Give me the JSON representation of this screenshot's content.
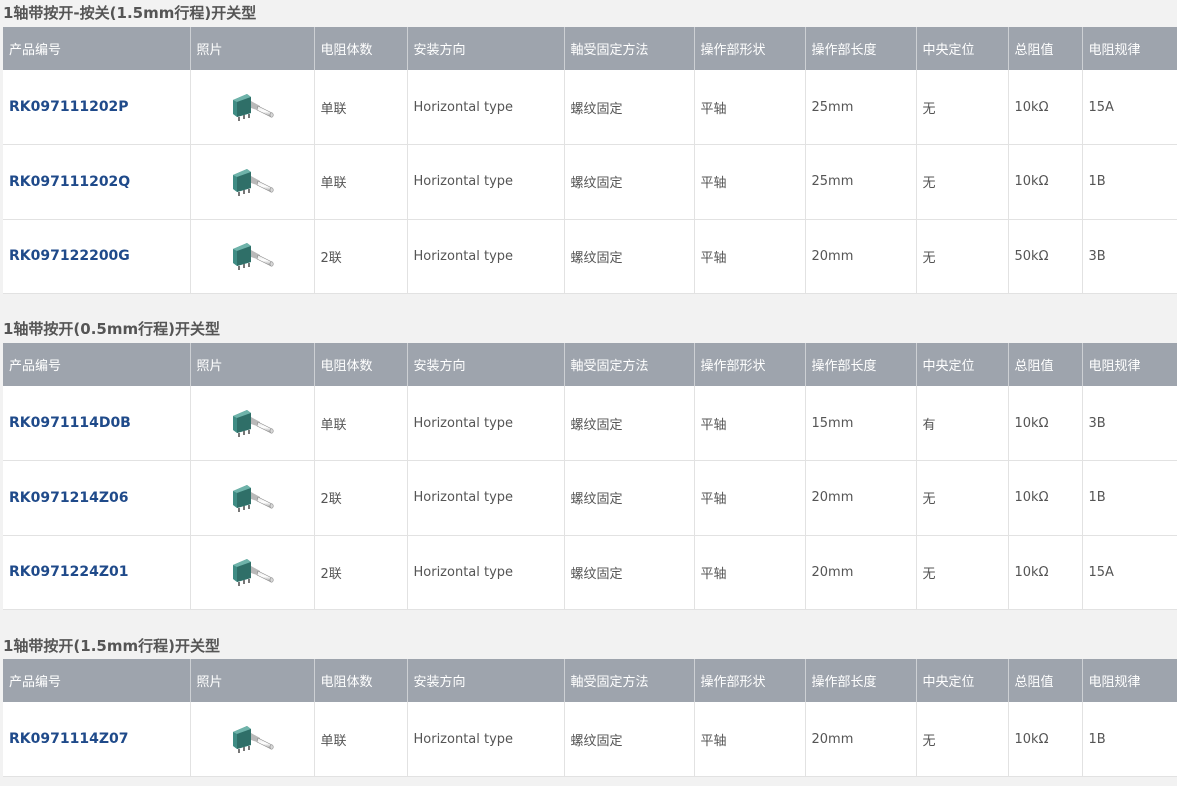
{
  "headers": [
    "产品编号",
    "照片",
    "电阻体数",
    "安装方向",
    "軸受固定方法",
    "操作部形状",
    "操作部长度",
    "中央定位",
    "总阻值",
    "电阻规律"
  ],
  "sections": [
    {
      "title": "1轴带按开-按关(1.5mm行程)开关型",
      "rows": [
        {
          "pn": "RK097111202P",
          "gangs": "单联",
          "mount": "Horizontal type",
          "bearing": "螺纹固定",
          "shape": "平轴",
          "length": "25mm",
          "detent": "无",
          "resistance": "10kΩ",
          "taper": "15A"
        },
        {
          "pn": "RK097111202Q",
          "gangs": "单联",
          "mount": "Horizontal type",
          "bearing": "螺纹固定",
          "shape": "平轴",
          "length": "25mm",
          "detent": "无",
          "resistance": "10kΩ",
          "taper": "1B"
        },
        {
          "pn": "RK097122200G",
          "gangs": "2联",
          "mount": "Horizontal type",
          "bearing": "螺纹固定",
          "shape": "平轴",
          "length": "20mm",
          "detent": "无",
          "resistance": "50kΩ",
          "taper": "3B"
        }
      ]
    },
    {
      "title": "1轴带按开(0.5mm行程)开关型",
      "rows": [
        {
          "pn": "RK0971114D0B",
          "gangs": "单联",
          "mount": "Horizontal type",
          "bearing": "螺纹固定",
          "shape": "平轴",
          "length": "15mm",
          "detent": "有",
          "resistance": "10kΩ",
          "taper": "3B"
        },
        {
          "pn": "RK0971214Z06",
          "gangs": "2联",
          "mount": "Horizontal type",
          "bearing": "螺纹固定",
          "shape": "平轴",
          "length": "20mm",
          "detent": "无",
          "resistance": "10kΩ",
          "taper": "1B"
        },
        {
          "pn": "RK0971224Z01",
          "gangs": "2联",
          "mount": "Horizontal type",
          "bearing": "螺纹固定",
          "shape": "平轴",
          "length": "20mm",
          "detent": "无",
          "resistance": "10kΩ",
          "taper": "15A"
        }
      ]
    },
    {
      "title": "1轴带按开(1.5mm行程)开关型",
      "rows": [
        {
          "pn": "RK0971114Z07",
          "gangs": "单联",
          "mount": "Horizontal type",
          "bearing": "螺纹固定",
          "shape": "平轴",
          "length": "20mm",
          "detent": "无",
          "resistance": "10kΩ",
          "taper": "1B"
        }
      ]
    }
  ],
  "icons": {
    "photo": "potentiometer-photo"
  },
  "colors": {
    "header_bg": "#9ea4ad",
    "link": "#1f4a8a",
    "page_bg": "#f2f2f2"
  }
}
